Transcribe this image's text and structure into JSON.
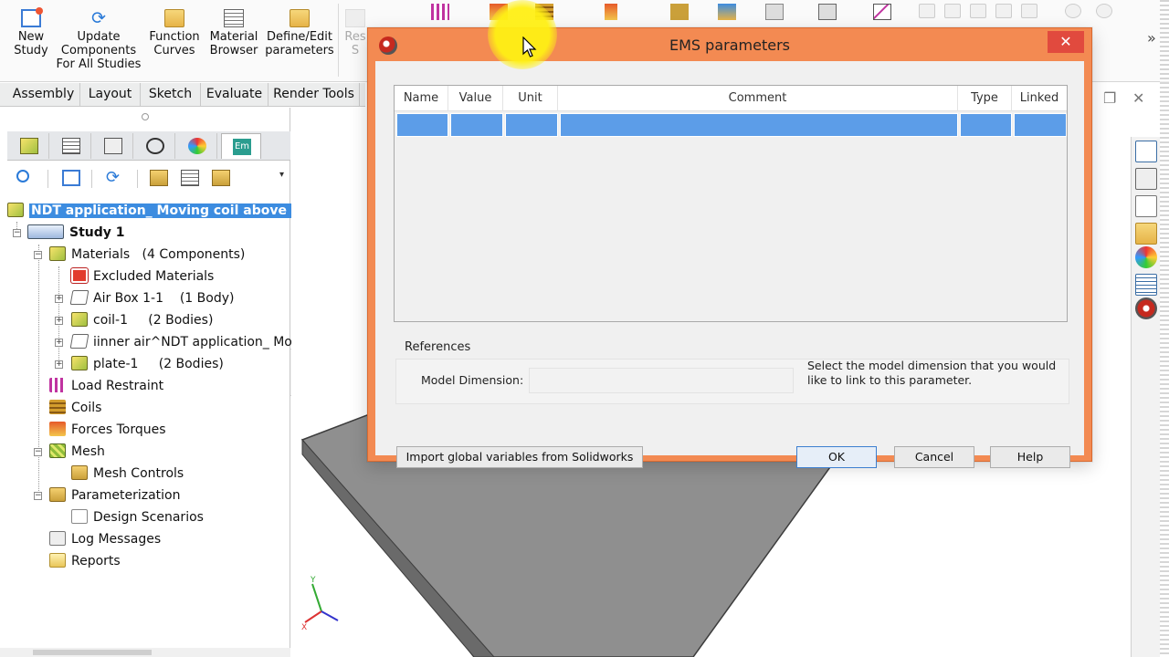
{
  "ribbon": {
    "buttons": [
      {
        "label": "New\nStudy"
      },
      {
        "label": "Update\nComponents\nFor All Studies"
      },
      {
        "label": "Function\nCurves"
      },
      {
        "label": "Material\nBrowser"
      },
      {
        "label": "Define/Edit\nparameters"
      },
      {
        "label": "Res\nS"
      }
    ],
    "tabs": [
      "Assembly",
      "Layout",
      "Sketch",
      "Evaluate",
      "Render Tools"
    ]
  },
  "panel": {
    "em_tab_label": "Em"
  },
  "tree": {
    "root": "NDT application_ Moving coil above cond",
    "study": "Study 1",
    "materials": "Materials",
    "materials_count": "(4 Components)",
    "excluded": "Excluded Materials",
    "airbox": "Air Box 1-1",
    "airbox_count": "(1 Body)",
    "coil": "coil-1",
    "coil_count": "(2 Bodies)",
    "inner_air": "iinner air^NDT application_ Movi",
    "plate": "plate-1",
    "plate_count": "(2 Bodies)",
    "load": "Load Restraint",
    "coils": "Coils",
    "forces": "Forces Torques",
    "mesh": "Mesh",
    "mesh_controls": "Mesh Controls",
    "param": "Parameterization",
    "design": "Design Scenarios",
    "log": "Log Messages",
    "reports": "Reports"
  },
  "dialog": {
    "title": "EMS parameters",
    "close": "✕",
    "columns": [
      "Name",
      "Value",
      "Unit",
      "Comment",
      "Type",
      "Linked"
    ],
    "references_label": "References",
    "model_dimension_label": "Model Dimension:",
    "model_dimension_value": "",
    "hint": "Select the model dimension that you would like to link to this parameter.",
    "import_button": "Import global variables from Solidworks",
    "ok": "OK",
    "cancel": "Cancel",
    "help": "Help"
  },
  "colors": {
    "dialog_frame": "#f38a52",
    "selection": "#3c8ce0",
    "grid_selection": "#5c9de8",
    "close_button": "#e14a3e"
  }
}
